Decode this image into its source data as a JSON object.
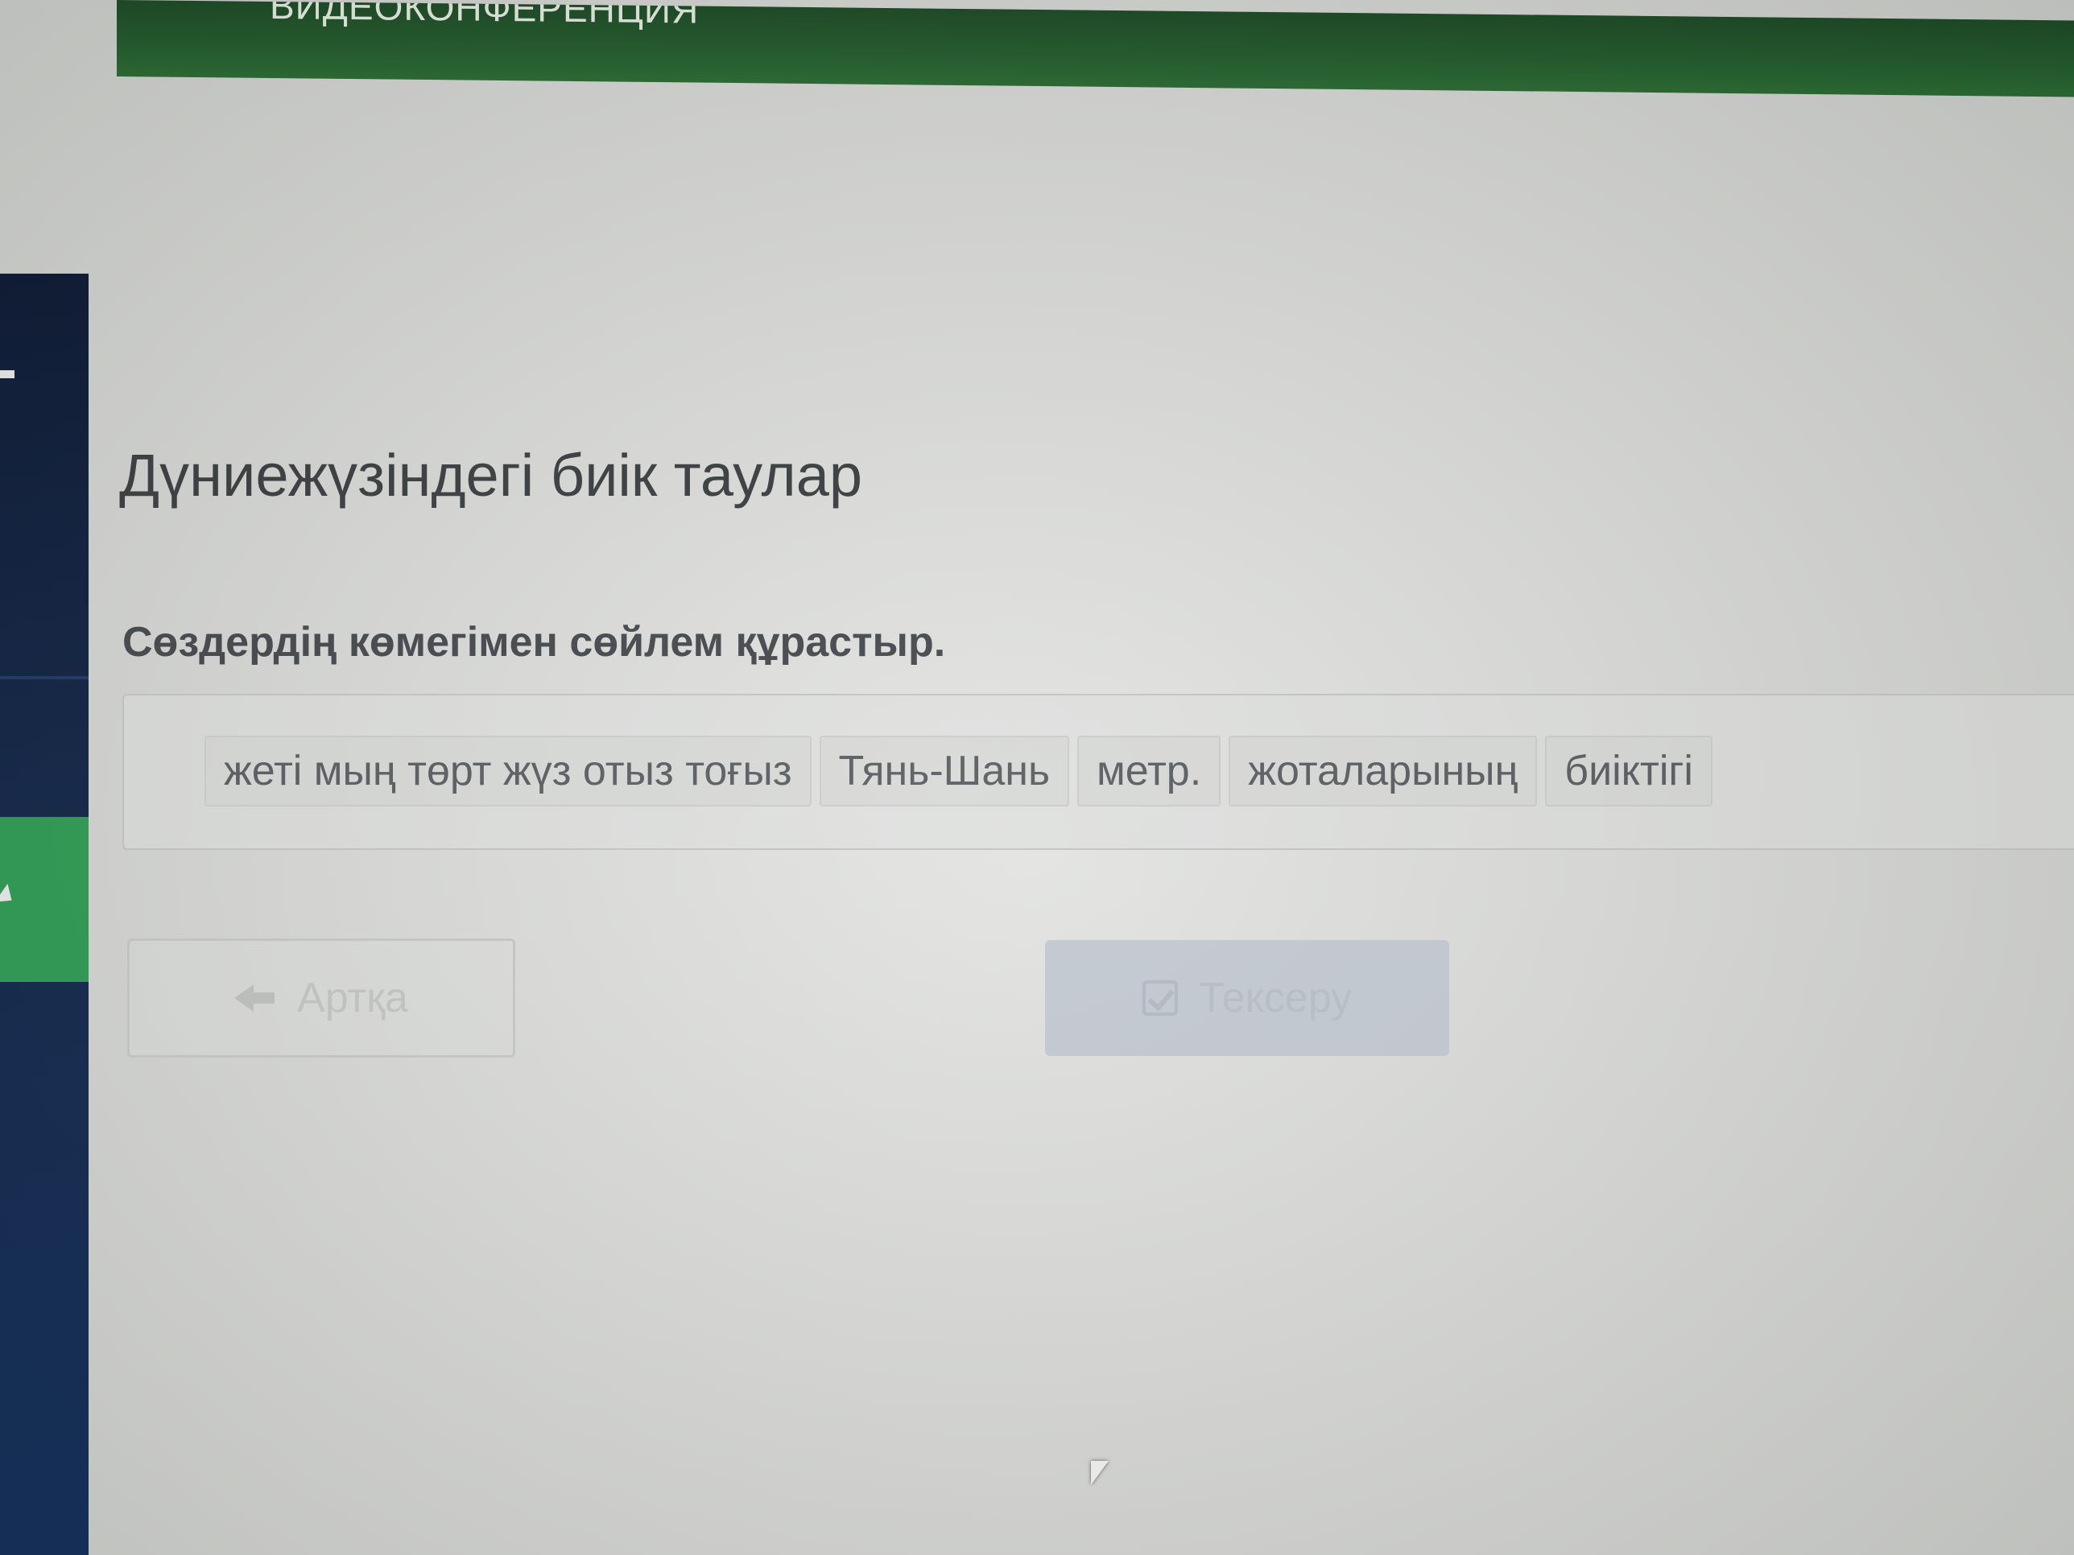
{
  "header": {
    "title": "ВИДЕОКОНФЕРЕНЦИЯ"
  },
  "lesson": {
    "title": "Дүниежүзіндегі биік таулар",
    "instruction": "Сөздердің көмегімен сөйлем құрастыр."
  },
  "word_bank": [
    "жеті мың төрт жүз отыз тоғыз",
    "Тянь-Шань",
    "метр.",
    "жоталарының",
    "биіктігі"
  ],
  "buttons": {
    "back_label": "Артқа",
    "check_label": "Тексеру"
  },
  "icons": {
    "back": "arrow-left-icon",
    "check": "check-icon",
    "cursor": "mouse-cursor-icon"
  },
  "colors": {
    "header_green": "#235a2c",
    "sidebar_navy": "#132647",
    "sidebar_active_green": "#2f9a53",
    "check_button_disabled": "#c4cad2"
  }
}
